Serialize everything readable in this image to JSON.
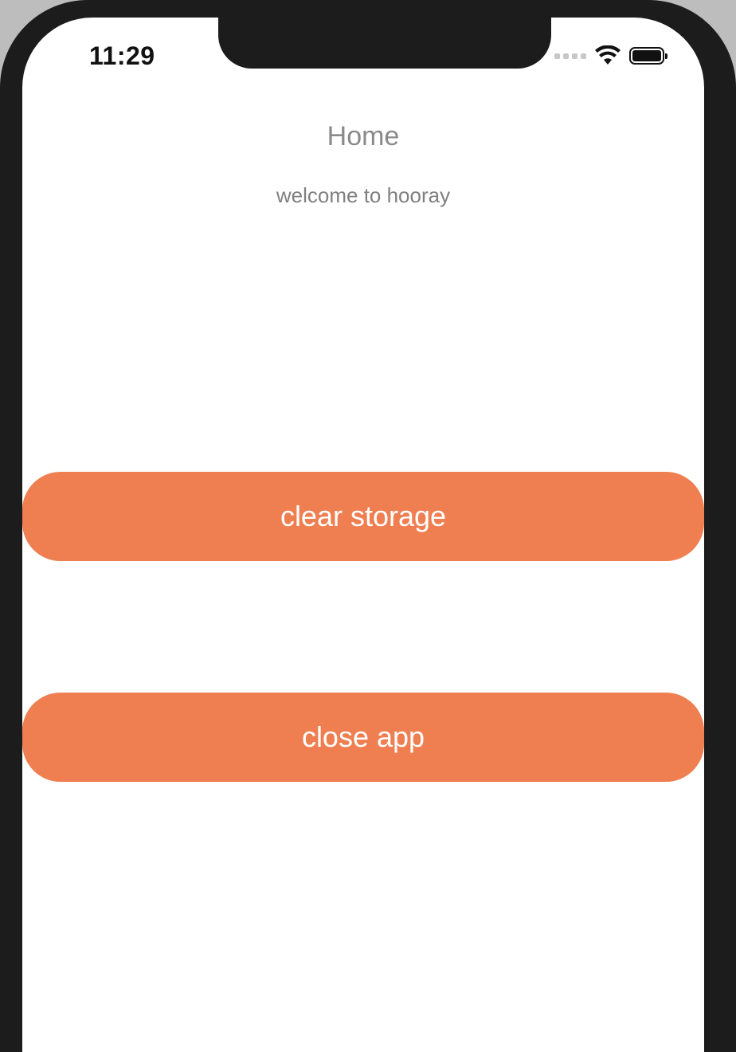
{
  "status_bar": {
    "time": "11:29",
    "icons": [
      "cellular-signal-icon",
      "wifi-icon",
      "battery-icon"
    ]
  },
  "header": {
    "title": "Home"
  },
  "main": {
    "subtitle": "welcome to hooray",
    "buttons": [
      {
        "label": "clear storage"
      },
      {
        "label": "close app"
      }
    ]
  },
  "colors": {
    "accent": "#ef7f51",
    "title_text": "#8a8a8a",
    "subtitle_text": "#808080",
    "frame": "#1c1c1c",
    "background": "#ffffff"
  }
}
